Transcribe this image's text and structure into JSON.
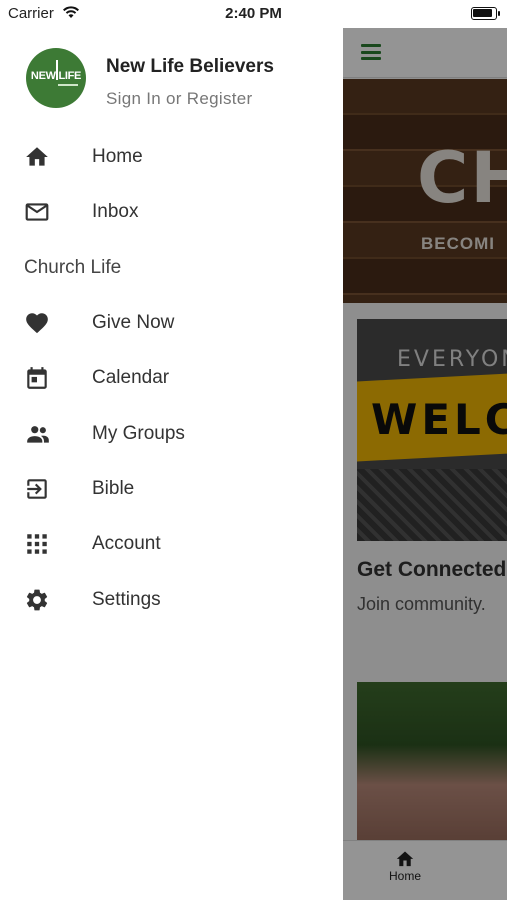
{
  "status_bar": {
    "carrier": "Carrier",
    "time": "2:40 PM"
  },
  "drawer": {
    "org_name": "New Life Believers",
    "auth_link": "Sign In or Register",
    "logo_text": "NEW LIFE",
    "items": [
      {
        "label": "Home",
        "icon": "home-icon"
      },
      {
        "label": "Inbox",
        "icon": "mail-icon"
      }
    ],
    "section_header": "Church Life",
    "section_items": [
      {
        "label": "Give Now",
        "icon": "heart-icon"
      },
      {
        "label": "Calendar",
        "icon": "calendar-icon"
      },
      {
        "label": "My Groups",
        "icon": "people-icon"
      },
      {
        "label": "Bible",
        "icon": "login-arrow-icon"
      },
      {
        "label": "Account",
        "icon": "grid-icon"
      },
      {
        "label": "Settings",
        "icon": "gear-icon"
      }
    ]
  },
  "background_app": {
    "hero_text": "CH",
    "hero_subtext": "BECOMI",
    "card1_sign_top": "EVERYON",
    "card1_sign": "WELCO",
    "card_title": "Get Connected",
    "card_subtitle": "Join community.",
    "tabbar": {
      "home_label": "Home"
    },
    "accent_color": "#2e7d32"
  }
}
